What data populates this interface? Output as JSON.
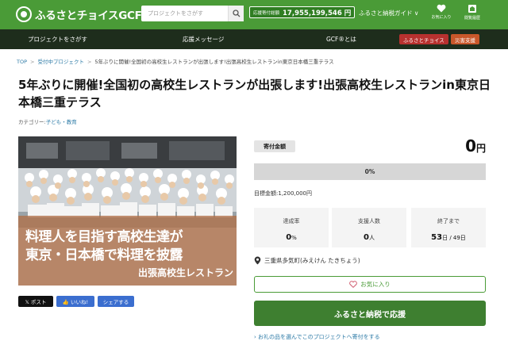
{
  "header": {
    "logo_text": "ふるさとチョイスGCF",
    "search_placeholder": "プロジェクトをさがす",
    "donation_total_label": "応援寄付総額",
    "donation_total_value": "17,955,199,546 円",
    "guide_label": "ふるさと納税ガイド ∨",
    "favorites_label": "お気に入り",
    "history_label": "閲覧履歴",
    "colors": {
      "brand": "#4a9b37",
      "nav": "#1e2d1c"
    }
  },
  "nav": {
    "find_projects": "プロジェクトをさがす",
    "messages": "応援メッセージ",
    "about": "GCF®とは",
    "choice_badge": "ふるさとチョイス",
    "disaster_badge": "災害支援"
  },
  "breadcrumb": {
    "top": "TOP",
    "active": "受付中プロジェクト",
    "current": "5年ぶりに開催!全国初の高校生レストランが出張します!出張高校生レストランin東京日本橋三重テラス"
  },
  "project": {
    "title": "5年ぶりに開催!全国初の高校生レストランが出張します!出張高校生レストランin東京日本橋三重テラス",
    "category_label": "カテゴリー:",
    "category_value": "子ども・教育",
    "image_line1": "料理人を目指す高校生達が",
    "image_line2": "東京・日本橋で料理を披露",
    "image_line3": "出張高校生レストラン"
  },
  "share": {
    "x_post": "𝕏 ポスト",
    "like": "👍 いいね!",
    "share": "シェアする"
  },
  "funding": {
    "amount_label": "寄付金額",
    "amount_value": "0",
    "amount_unit": "円",
    "progress_text": "0%",
    "progress_fraction": 0,
    "goal_label": "目標金額:",
    "goal_value": "1,200,000円",
    "stats": {
      "rate_label": "達成率",
      "rate_value": "0",
      "rate_unit": "%",
      "supporters_label": "支援人数",
      "supporters_value": "0",
      "supporters_unit": "人",
      "deadline_label": "終了まで",
      "deadline_value": "53",
      "deadline_unit": "日 / 49日"
    },
    "location": "三重県多気町(みえけん たきちょう)",
    "favorite_button": "お気に入り",
    "donate_button": "ふるさと納税で応援",
    "gift_link": "お礼の品を選んでこのプロジェクトへ寄付をする"
  }
}
